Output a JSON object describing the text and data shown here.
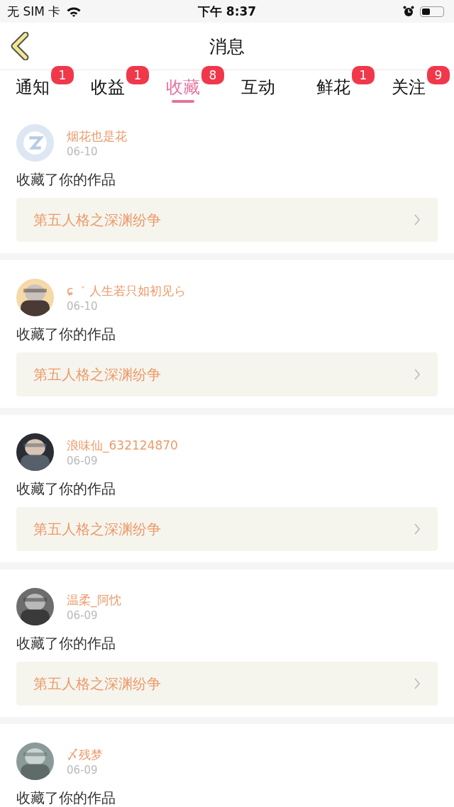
{
  "status_bar": {
    "carrier": "无 SIM 卡",
    "time": "下午 8:37"
  },
  "nav": {
    "title": "消息"
  },
  "tabs": [
    {
      "label": "通知",
      "badge": "1",
      "selected": false
    },
    {
      "label": "收益",
      "badge": "1",
      "selected": false
    },
    {
      "label": "收藏",
      "badge": "8",
      "selected": true
    },
    {
      "label": "互动",
      "selected": false
    },
    {
      "label": "鲜花",
      "badge": "1",
      "selected": false
    },
    {
      "label": "关注",
      "badge": "9",
      "selected": false
    }
  ],
  "messages": [
    {
      "kind": "default",
      "user": "烟花也是花",
      "date": "06-10",
      "action": "收藏了你的作品",
      "work": "第五人格之深渊纷争"
    },
    {
      "kind": "picture",
      "user": "ɕ゛ 人生若只如初见ら",
      "date": "06-10",
      "action": "收藏了你的作品",
      "work": "第五人格之深渊纷争"
    },
    {
      "kind": "picture",
      "user": "浪味仙_632124870",
      "date": "06-09",
      "action": "收藏了你的作品",
      "work": "第五人格之深渊纷争"
    },
    {
      "kind": "picture",
      "user": "温柔_阿忱",
      "date": "06-09",
      "action": "收藏了你的作品",
      "work": "第五人格之深渊纷争"
    },
    {
      "kind": "picture",
      "user": "〆残梦",
      "date": "06-09",
      "action": "收藏了你的作品"
    }
  ]
}
